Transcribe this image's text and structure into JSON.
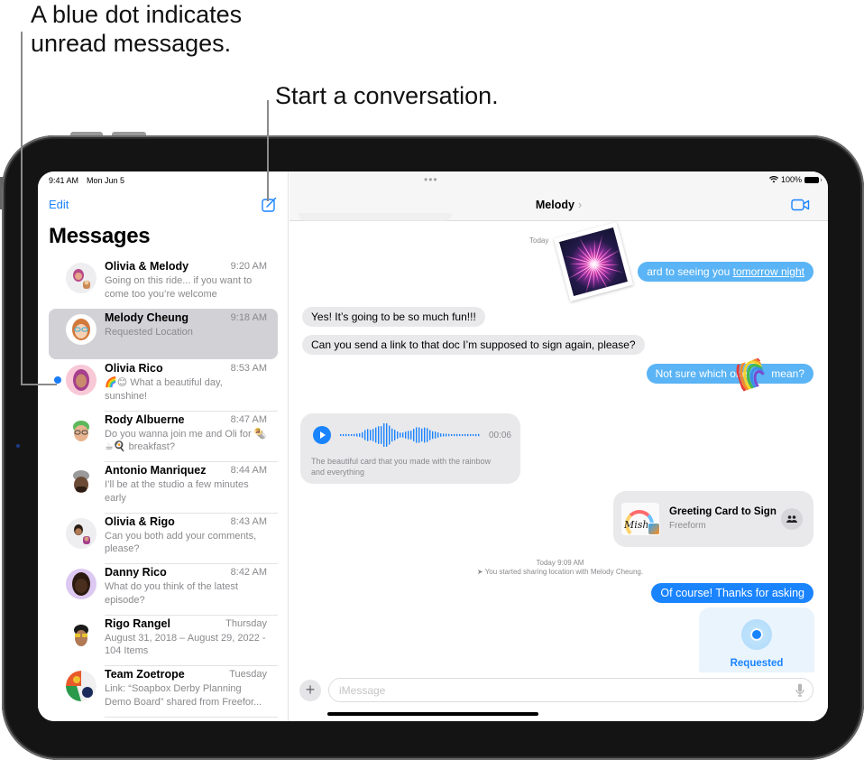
{
  "callouts": {
    "unread": "A blue dot indicates unread messages.",
    "compose": "Start a conversation."
  },
  "status_bar": {
    "time": "9:41 AM",
    "date": "Mon Jun 5",
    "battery": "100%",
    "multitask_dots": "•••"
  },
  "sidebar": {
    "edit_label": "Edit",
    "title": "Messages",
    "compose_icon": "square-and-pencil-icon",
    "conversations": [
      {
        "name": "Olivia & Melody",
        "time": "9:20 AM",
        "preview": "Going on this ride... if you want to come too you’re welcome",
        "unread": false,
        "selected": false
      },
      {
        "name": "Melody Cheung",
        "time": "9:18 AM",
        "preview": "Requested Location",
        "unread": false,
        "selected": true
      },
      {
        "name": "Olivia Rico",
        "time": "8:53 AM",
        "preview": "🌈😊 What a beautiful day, sunshine!",
        "unread": true,
        "selected": false
      },
      {
        "name": "Rody Albuerne",
        "time": "8:47 AM",
        "preview": "Do you wanna join me and Oli for 🌯☕🍳 breakfast?",
        "unread": false,
        "selected": false
      },
      {
        "name": "Antonio Manriquez",
        "time": "8:44 AM",
        "preview": "I’ll be at the studio a few minutes early",
        "unread": false,
        "selected": false
      },
      {
        "name": "Olivia & Rigo",
        "time": "8:43 AM",
        "preview": "Can you both add your comments, please?",
        "unread": false,
        "selected": false
      },
      {
        "name": "Danny Rico",
        "time": "8:42 AM",
        "preview": "What do you think of the latest episode?",
        "unread": false,
        "selected": false
      },
      {
        "name": "Rigo Rangel",
        "time": "Thursday",
        "preview": "August 31, 2018 – August 29, 2022 - 104 Items",
        "unread": false,
        "selected": false
      },
      {
        "name": "Team Zoetrope",
        "time": "Tuesday",
        "preview": "Link: “Soapbox Derby Planning Demo Board” shared from Freefor...",
        "unread": false,
        "selected": false
      }
    ]
  },
  "chat": {
    "title": "Melody",
    "title_chevron": "›",
    "video_icon": "video-camera-icon",
    "timestamp_today": "Today",
    "messages": {
      "out_1_prefix": "ard to seeing you ",
      "out_1_link": "tomorrow night",
      "in_1": "Yes! It’s going to be so much fun!!!",
      "in_2": "Can you send a link to that doc I’m supposed to sign again, please?",
      "out_2_a": "Not sure which one",
      "out_2_b": "mean?",
      "audio_duration": "00:06",
      "audio_caption": "The beautiful card that you made with the rainbow and everything",
      "card_title": "Greeting Card to Sign",
      "card_app": "Freeform",
      "card_thumb_text": "Mish",
      "location_timestamp": "Today 9:09 AM",
      "location_note": "You started sharing location with Melody Cheung.",
      "out_3": "Of course! Thanks for asking",
      "location_status": "Requested"
    },
    "composer": {
      "placeholder": "iMessage",
      "plus_label": "+"
    }
  },
  "colors": {
    "accent": "#1a84ff",
    "unread_dot": "#1a7cf5",
    "outgoing_bubble": "#5ab4f5",
    "incoming_bubble": "#e9e9eb",
    "selected_row": "#d1d1d6"
  }
}
